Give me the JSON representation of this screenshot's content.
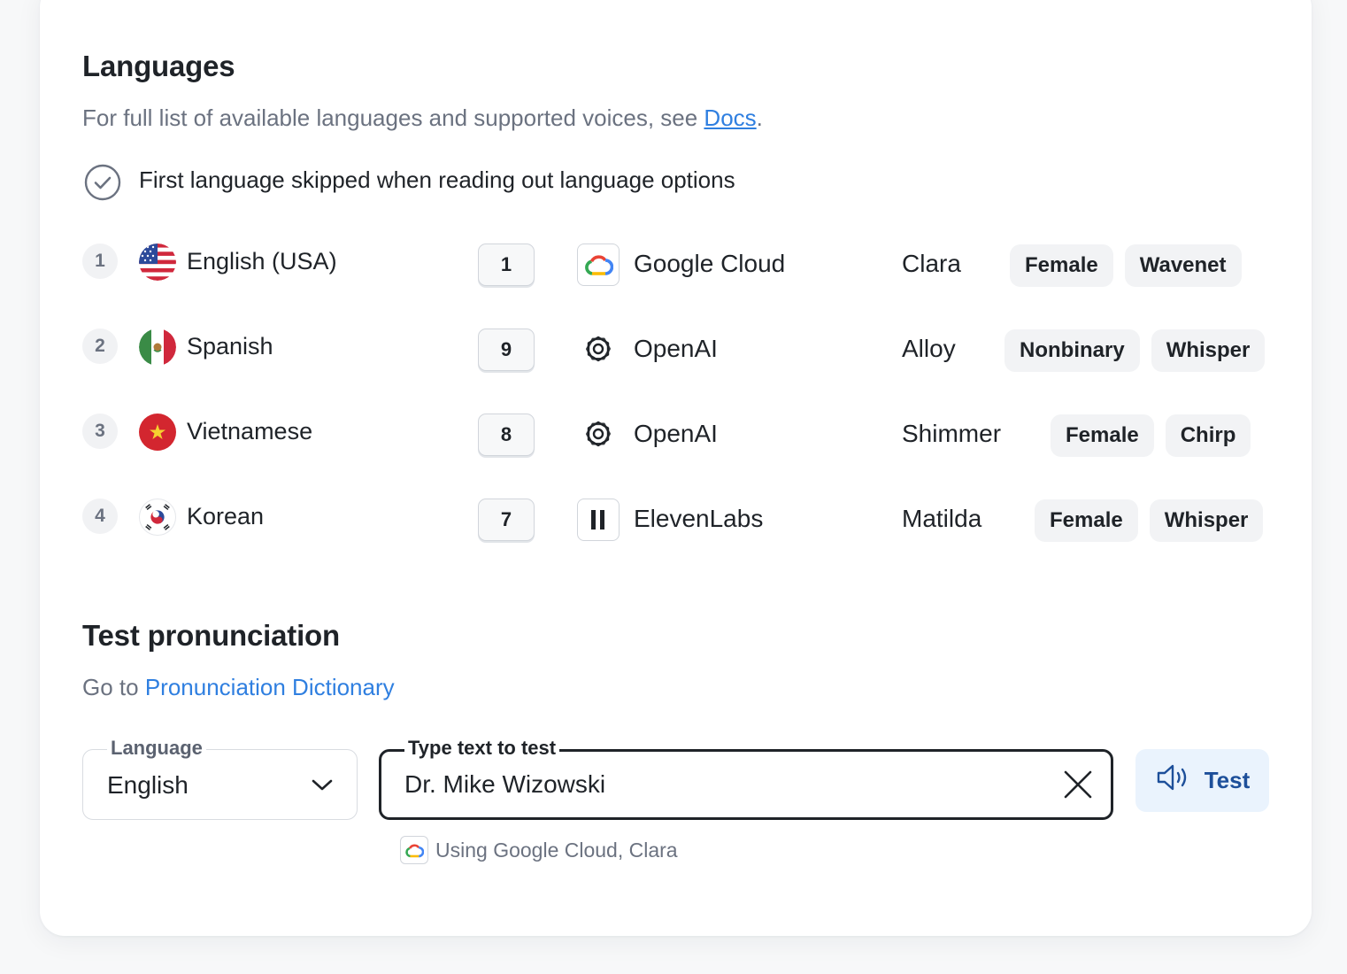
{
  "languages": {
    "title": "Languages",
    "desc_prefix": "For full list of available languages and supported voices, see ",
    "docs_link": "Docs",
    "desc_suffix": ".",
    "note": "First language skipped when reading out language options",
    "rows": [
      {
        "num": "1",
        "flag": "us-flag-icon",
        "name": "English (USA)",
        "key": "1",
        "provider": "Google Cloud",
        "provider_icon": "google-cloud-icon",
        "voice": "Clara",
        "tags": [
          "Female",
          "Wavenet"
        ]
      },
      {
        "num": "2",
        "flag": "mexico-flag-icon",
        "name": "Spanish",
        "key": "9",
        "provider": "OpenAI",
        "provider_icon": "openai-icon",
        "voice": "Alloy",
        "tags": [
          "Nonbinary",
          "Whisper"
        ]
      },
      {
        "num": "3",
        "flag": "vietnam-flag-icon",
        "name": "Vietnamese",
        "key": "8",
        "provider": "OpenAI",
        "provider_icon": "openai-icon",
        "voice": "Shimmer",
        "tags": [
          "Female",
          "Chirp"
        ]
      },
      {
        "num": "4",
        "flag": "korea-flag-icon",
        "name": "Korean",
        "key": "7",
        "provider": "ElevenLabs",
        "provider_icon": "elevenlabs-icon",
        "voice": "Matilda",
        "tags": [
          "Female",
          "Whisper"
        ]
      }
    ]
  },
  "test": {
    "title": "Test pronunciation",
    "goto_prefix": "Go to ",
    "dict_link": "Pronunciation Dictionary",
    "language_label": "Language",
    "language_value": "English",
    "text_label": "Type text to test",
    "text_value": "Dr. Mike Wizowski",
    "button_label": "Test",
    "hint": "Using Google Cloud, Clara"
  },
  "colors": {
    "link": "#2f7fe0",
    "button_bg": "#eaf3fd",
    "button_text": "#1d4f9a"
  }
}
